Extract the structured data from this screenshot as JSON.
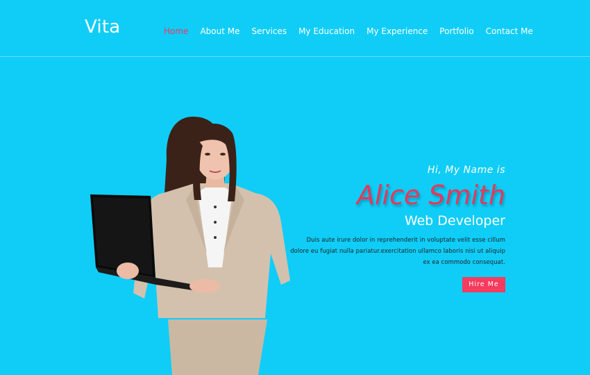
{
  "header": {
    "logo": "Vita",
    "nav": [
      "Home",
      "About Me",
      "Services",
      "My Education",
      "My Experience",
      "Portfolio",
      "Contact Me"
    ],
    "active_index": 0
  },
  "hero": {
    "greeting": "Hi, My Name is",
    "name": "Alice Smith",
    "role": "Web Developer",
    "description_lines": [
      "Duis aute irure dolor in reprehenderit in voluptate velit esse cillum",
      "dolore eu fugiat nulla pariatur.exercitation ullamco laboris nisi ut aliquip",
      "ex ea commodo consequat."
    ],
    "cta": "Hire Me"
  },
  "colors": {
    "background": "#0fcdf7",
    "accent": "#f0365f"
  }
}
